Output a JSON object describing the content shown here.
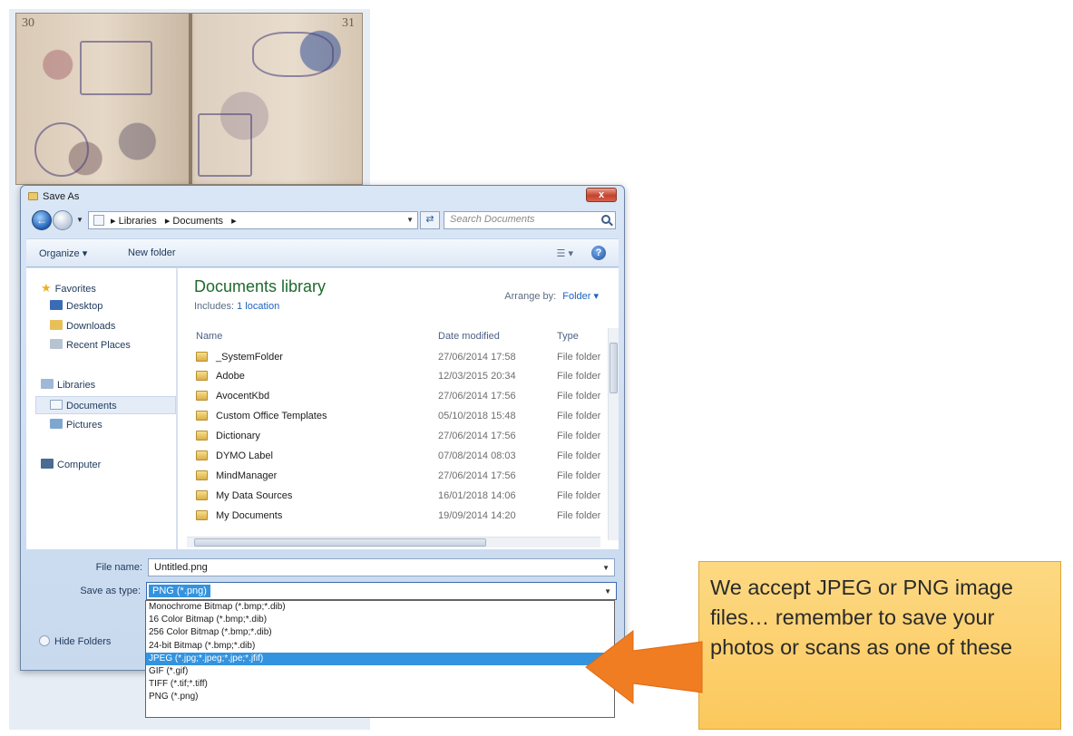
{
  "passport": {
    "page_left": "30",
    "page_right": "31"
  },
  "dialog": {
    "title": "Save As",
    "close_label": "x",
    "address": {
      "crumbs": [
        "▸ Libraries",
        "▸ Documents",
        "▸"
      ]
    },
    "search_placeholder": "Search Documents",
    "toolbar": {
      "organize": "Organize ▾",
      "new_folder": "New folder",
      "help": "?"
    },
    "nav": {
      "favorites": "Favorites",
      "desktop": "Desktop",
      "downloads": "Downloads",
      "recent": "Recent Places",
      "libraries": "Libraries",
      "documents": "Documents",
      "pictures": "Pictures",
      "computer": "Computer"
    },
    "library": {
      "title": "Documents library",
      "includes_label": "Includes:",
      "includes_link": "1 location",
      "arrange_label": "Arrange by:",
      "arrange_value": "Folder ▾"
    },
    "columns": {
      "name": "Name",
      "date": "Date modified",
      "type": "Type"
    },
    "files": [
      {
        "name": "_SystemFolder",
        "date": "27/06/2014 17:58",
        "type": "File folder"
      },
      {
        "name": "Adobe",
        "date": "12/03/2015 20:34",
        "type": "File folder"
      },
      {
        "name": "AvocentKbd",
        "date": "27/06/2014 17:56",
        "type": "File folder"
      },
      {
        "name": "Custom Office Templates",
        "date": "05/10/2018 15:48",
        "type": "File folder"
      },
      {
        "name": "Dictionary",
        "date": "27/06/2014 17:56",
        "type": "File folder"
      },
      {
        "name": "DYMO Label",
        "date": "07/08/2014 08:03",
        "type": "File folder"
      },
      {
        "name": "MindManager",
        "date": "27/06/2014 17:56",
        "type": "File folder"
      },
      {
        "name": "My Data Sources",
        "date": "16/01/2018 14:06",
        "type": "File folder"
      },
      {
        "name": "My Documents",
        "date": "19/09/2014 14:20",
        "type": "File folder"
      }
    ],
    "file_name_label": "File name:",
    "file_name_value": "Untitled.png",
    "save_type_label": "Save as type:",
    "save_type_value": "PNG (*.png)",
    "hide_folders": "Hide Folders"
  },
  "dropdown_options": [
    {
      "label": "Monochrome Bitmap (*.bmp;*.dib)",
      "highlighted": false
    },
    {
      "label": "16 Color Bitmap (*.bmp;*.dib)",
      "highlighted": false
    },
    {
      "label": "256 Color Bitmap (*.bmp;*.dib)",
      "highlighted": false
    },
    {
      "label": "24-bit Bitmap (*.bmp;*.dib)",
      "highlighted": false
    },
    {
      "label": "JPEG (*.jpg;*.jpeg;*.jpe;*.jfif)",
      "highlighted": true
    },
    {
      "label": "GIF (*.gif)",
      "highlighted": false
    },
    {
      "label": "TIFF (*.tif;*.tiff)",
      "highlighted": false
    },
    {
      "label": "PNG (*.png)",
      "highlighted": false
    }
  ],
  "callout": {
    "text": "We accept JPEG or PNG image files… remember to save your photos or scans as one of these"
  },
  "colors": {
    "callout_bg": "#fbc85c",
    "arrow": "#f07d22",
    "selection": "#3393df",
    "library_title": "#1e6a2e"
  }
}
